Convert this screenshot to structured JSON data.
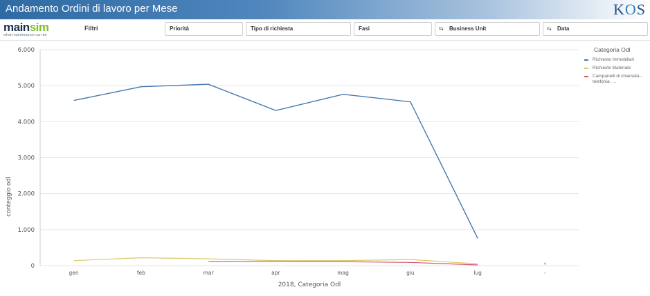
{
  "header": {
    "title": "Andamento Ordini di lavoro per Mese",
    "logo_text": "KOS"
  },
  "brand": {
    "name_part1": "main",
    "name_part2": "sim",
    "tagline": "what maintenance can be"
  },
  "filters": {
    "label": "Filtri",
    "items": [
      {
        "label": "Priorità",
        "icon": ""
      },
      {
        "label": "Tipo di richiesta",
        "icon": ""
      },
      {
        "label": "Fasi",
        "icon": ""
      },
      {
        "label": "Business Unit",
        "icon": "calendar-swap-icon"
      },
      {
        "label": "Data",
        "icon": "calendar-swap-icon"
      }
    ]
  },
  "colors": {
    "header_blue": "#2f6aa3",
    "series_1": "#4477aa",
    "series_2": "#dcc86a",
    "series_3": "#d6506e"
  },
  "chart_data": {
    "type": "line",
    "xlabel": "2018, Categoria Odl",
    "ylabel": "conteggio odl",
    "categories": [
      "gen",
      "feb",
      "mar",
      "apr",
      "mag",
      "giu",
      "lug",
      "-"
    ],
    "y_ticks": [
      "0",
      "1.000",
      "2.000",
      "3.000",
      "4.000",
      "5.000",
      "6.000"
    ],
    "ylim": [
      0,
      6000
    ],
    "grid": true,
    "legend": {
      "title": "Categoria Odl",
      "placement": "right"
    },
    "series": [
      {
        "name": "Richieste Immobiliari",
        "values": [
          4590,
          4970,
          5040,
          4310,
          4760,
          4550,
          760,
          null
        ]
      },
      {
        "name": "Richieste Materiale",
        "values": [
          140,
          220,
          190,
          140,
          140,
          170,
          50,
          null
        ]
      },
      {
        "name": "Campanelli di chiamata -telefonia- ...",
        "values": [
          null,
          null,
          110,
          120,
          110,
          90,
          20,
          null
        ]
      }
    ],
    "extra_point_value": 0
  }
}
